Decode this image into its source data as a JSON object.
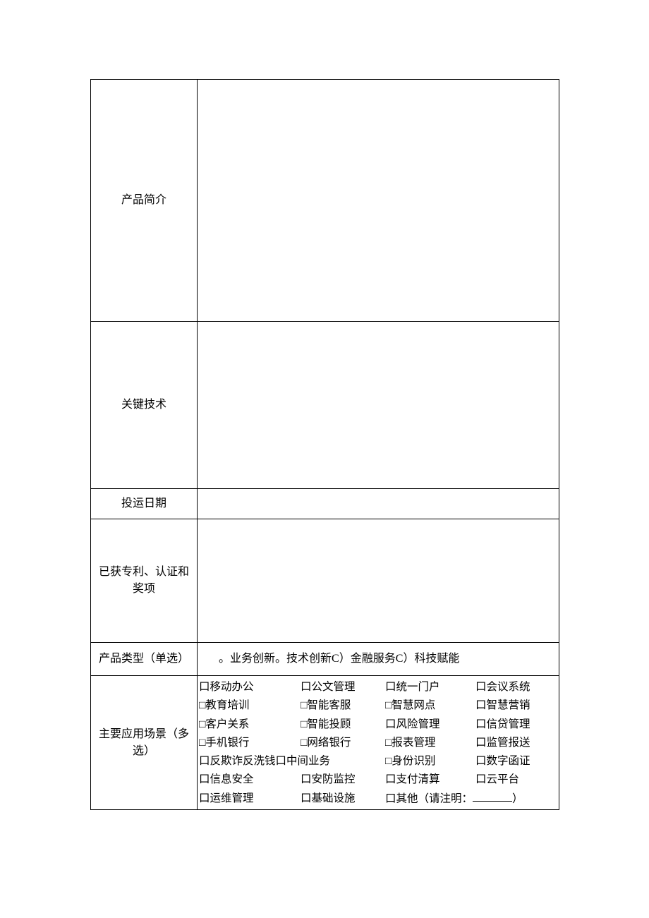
{
  "rows": {
    "intro_label": "产品简介",
    "tech_label": "关键技术",
    "date_label": "投运日期",
    "patent_label": "已获专利、认证和奖项",
    "type_label": "产品类型（单选）",
    "scenes_label": "主要应用场景（多选）"
  },
  "type_options": {
    "o1": "。业务创新",
    "o2": "。技术创新",
    "o3": "C）金融服务",
    "o4": "C）科技赋能"
  },
  "scenes": [
    [
      "口移动办公",
      "口公文管理",
      "口统一门户",
      "口会议系统"
    ],
    [
      "□教育培训",
      "□智能客服",
      "□智慧网点",
      "口智慧营销"
    ],
    [
      "□客户关系",
      "□智能投顾",
      "口风险管理",
      "口信贷管理"
    ],
    [
      "□手机银行",
      "□网络银行",
      "□报表管理",
      "口监管报送"
    ],
    [
      "口反欺诈反洗钱口中间业务",
      "",
      "□身份识别",
      "口数字函证"
    ],
    [
      "口信息安全",
      "口安防监控",
      "口支付清算",
      "口云平台"
    ],
    [
      "口运维管理",
      "口基础设施",
      "口其他（请注明：",
      "）"
    ]
  ]
}
